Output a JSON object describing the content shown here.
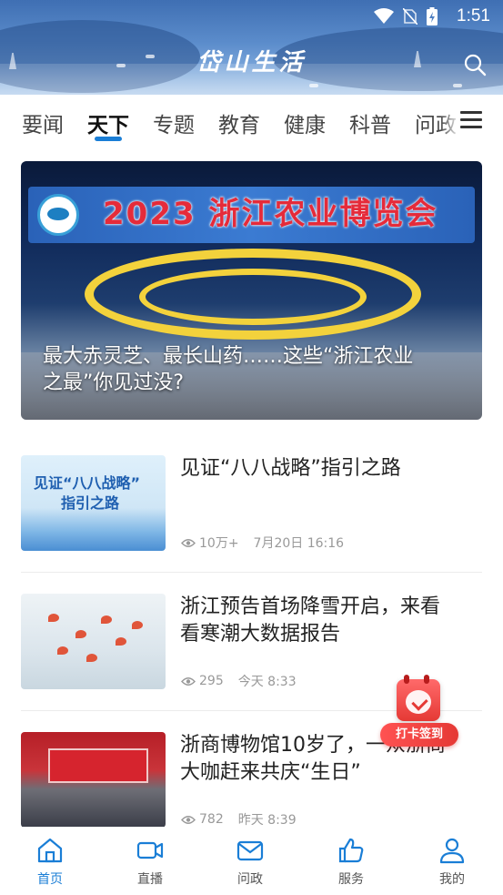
{
  "status_bar": {
    "time": "1:51"
  },
  "header": {
    "logo_text": "岱山生活"
  },
  "tabs": [
    {
      "label": "要闻",
      "active": false
    },
    {
      "label": "天下",
      "active": true
    },
    {
      "label": "专题",
      "active": false
    },
    {
      "label": "教育",
      "active": false
    },
    {
      "label": "健康",
      "active": false
    },
    {
      "label": "科普",
      "active": false
    },
    {
      "label": "问政",
      "active": false
    }
  ],
  "hero": {
    "banner_text": "2023 浙江农业博览会",
    "title_line1": "最大赤灵芝、最长山药……这些“浙江农业",
    "title_line2": "之最”你见过没?"
  },
  "news": [
    {
      "title_line1": "见证“八八战略”指引之路",
      "title_line2": "",
      "views": "10万+",
      "time": "7月20日 16:16",
      "thumb_text_line1": "见证“八八战略”",
      "thumb_text_line2": "指引之路"
    },
    {
      "title_line1": "浙江预告首场降雪开启，来看",
      "title_line2": "看寒潮大数据报告",
      "views": "295",
      "time": "今天 8:33"
    },
    {
      "title_line1": "浙商博物馆10岁了，一众浙商",
      "title_line2": "大咖赶来共庆“生日”",
      "views": "782",
      "time": "昨天 8:39"
    }
  ],
  "checkin": {
    "label": "打卡签到"
  },
  "bottom_nav": [
    {
      "label": "首页",
      "icon": "home-icon",
      "active": true
    },
    {
      "label": "直播",
      "icon": "video-camera-icon",
      "active": false
    },
    {
      "label": "问政",
      "icon": "mail-icon",
      "active": false
    },
    {
      "label": "服务",
      "icon": "thumbs-up-icon",
      "active": false
    },
    {
      "label": "我的",
      "icon": "user-icon",
      "active": false
    }
  ],
  "colors": {
    "accent": "#1a7ed6",
    "header": "#4f80c2",
    "checkin": "#e53935"
  }
}
